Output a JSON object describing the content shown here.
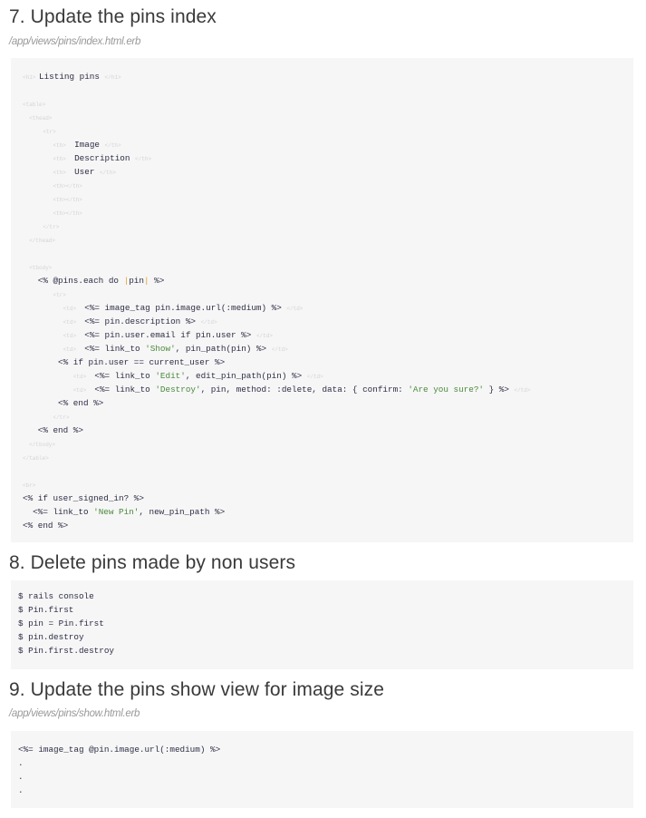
{
  "sections": [
    {
      "title": "7. Update the pins index",
      "path": "/app/views/pins/index.html.erb",
      "code": [
        [
          [
            "tag",
            "<h1> "
          ],
          [
            "c",
            "Listing pins "
          ],
          [
            "tag",
            "</h1>"
          ]
        ],
        [],
        [
          [
            "tag",
            "<table>"
          ]
        ],
        [
          [
            "tag",
            "  <thead>"
          ]
        ],
        [
          [
            "c",
            "    "
          ],
          [
            "tag",
            "<tr>"
          ]
        ],
        [
          [
            "c",
            "      "
          ],
          [
            "tag",
            "<th> "
          ],
          [
            "c",
            " Image "
          ],
          [
            "tag",
            "</th>"
          ]
        ],
        [
          [
            "c",
            "      "
          ],
          [
            "tag",
            "<th> "
          ],
          [
            "c",
            " Description "
          ],
          [
            "tag",
            "</th>"
          ]
        ],
        [
          [
            "c",
            "      "
          ],
          [
            "tag",
            "<th> "
          ],
          [
            "c",
            " User "
          ],
          [
            "tag",
            "</th>"
          ]
        ],
        [
          [
            "c",
            "      "
          ],
          [
            "tag",
            "<th></th>"
          ]
        ],
        [
          [
            "c",
            "      "
          ],
          [
            "tag",
            "<th></th>"
          ]
        ],
        [
          [
            "c",
            "      "
          ],
          [
            "tag",
            "<th></th>"
          ]
        ],
        [
          [
            "c",
            "    "
          ],
          [
            "tag",
            "</tr>"
          ]
        ],
        [
          [
            "tag",
            "  </thead>"
          ]
        ],
        [],
        [
          [
            "tag",
            "  <tbody>"
          ]
        ],
        [
          [
            "c",
            "   <% @pins.each do "
          ],
          [
            "bar",
            "|"
          ],
          [
            "c",
            "pin"
          ],
          [
            "bar",
            "|"
          ],
          [
            "c",
            " %>"
          ]
        ],
        [
          [
            "c",
            "      "
          ],
          [
            "tag",
            "<tr>"
          ]
        ],
        [
          [
            "c",
            "        "
          ],
          [
            "tag",
            "<td> "
          ],
          [
            "c",
            " <%= image_tag pin.image.url(:medium) %> "
          ],
          [
            "tag",
            "</td>"
          ]
        ],
        [
          [
            "c",
            "        "
          ],
          [
            "tag",
            "<td> "
          ],
          [
            "c",
            " <%= pin.description %> "
          ],
          [
            "tag",
            "</td>"
          ]
        ],
        [
          [
            "c",
            "        "
          ],
          [
            "tag",
            "<td> "
          ],
          [
            "c",
            " <%= pin.user.email if pin.user %> "
          ],
          [
            "tag",
            "</td>"
          ]
        ],
        [
          [
            "c",
            "        "
          ],
          [
            "tag",
            "<td> "
          ],
          [
            "c",
            " <%= link_to "
          ],
          [
            "str",
            "'Show'"
          ],
          [
            "c",
            ", pin_path(pin) %> "
          ],
          [
            "tag",
            "</td>"
          ]
        ],
        [
          [
            "c",
            "       <% if pin.user == current_user %>"
          ]
        ],
        [
          [
            "c",
            "          "
          ],
          [
            "tag",
            "<td> "
          ],
          [
            "c",
            " <%= link_to "
          ],
          [
            "str",
            "'Edit'"
          ],
          [
            "c",
            ", edit_pin_path(pin) %> "
          ],
          [
            "tag",
            "</td>"
          ]
        ],
        [
          [
            "c",
            "          "
          ],
          [
            "tag",
            "<td> "
          ],
          [
            "c",
            " <%= link_to "
          ],
          [
            "str",
            "'Destroy'"
          ],
          [
            "c",
            ", pin, method: :delete, data: { confirm: "
          ],
          [
            "str",
            "'Are you sure?'"
          ],
          [
            "c",
            " } %> "
          ],
          [
            "tag",
            "</td>"
          ]
        ],
        [
          [
            "c",
            "       <% end %>"
          ]
        ],
        [
          [
            "c",
            "      "
          ],
          [
            "tag",
            "</tr>"
          ]
        ],
        [
          [
            "c",
            "   <% end %>"
          ]
        ],
        [
          [
            "tag",
            "  </tbody>"
          ]
        ],
        [
          [
            "tag",
            "</table>"
          ]
        ],
        [],
        [
          [
            "tag",
            "<br>"
          ]
        ],
        [
          [
            "c",
            "<% if user_signed_in? %>"
          ]
        ],
        [
          [
            "c",
            "  <%= link_to "
          ],
          [
            "str",
            "'New Pin'"
          ],
          [
            "c",
            ", new_pin_path %>"
          ]
        ],
        [
          [
            "c",
            "<% end %>"
          ]
        ]
      ]
    },
    {
      "title": "8. Delete pins made by non users",
      "code": [
        [
          [
            "c",
            "$ rails console"
          ]
        ],
        [
          [
            "c",
            "$ Pin.first"
          ]
        ],
        [
          [
            "c",
            "$ pin = Pin.first"
          ]
        ],
        [
          [
            "c",
            "$ pin.destroy"
          ]
        ],
        [
          [
            "c",
            "$ Pin.first.destroy"
          ]
        ]
      ]
    },
    {
      "title": "9. Update the pins show view for image size",
      "path": "/app/views/pins/show.html.erb",
      "code": [
        [
          [
            "c",
            "<%= image_tag @pin.image.url(:medium) %>"
          ]
        ],
        [
          [
            "c",
            "."
          ]
        ],
        [
          [
            "c",
            "."
          ]
        ],
        [
          [
            "c",
            "."
          ]
        ]
      ]
    }
  ]
}
